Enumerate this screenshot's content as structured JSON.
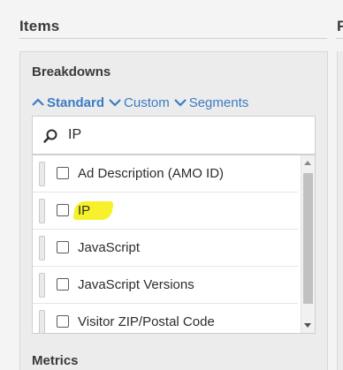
{
  "section": {
    "title": "Items",
    "next_title_fragment": "F"
  },
  "breakdowns": {
    "title": "Breakdowns",
    "filters": [
      {
        "label": "Standard",
        "active": true
      },
      {
        "label": "Custom",
        "active": false
      },
      {
        "label": "Segments",
        "active": false
      }
    ]
  },
  "search": {
    "value": "IP"
  },
  "items": [
    {
      "label": "Ad Description (AMO ID)",
      "checked": false,
      "highlighted": false
    },
    {
      "label": "IP",
      "checked": false,
      "highlighted": true
    },
    {
      "label": "JavaScript",
      "checked": false,
      "highlighted": false
    },
    {
      "label": "JavaScript Versions",
      "checked": false,
      "highlighted": false
    },
    {
      "label": "Visitor ZIP/Postal Code",
      "checked": false,
      "highlighted": false
    }
  ],
  "metrics": {
    "title": "Metrics"
  },
  "colors": {
    "link": "#3b7bc4",
    "highlight": "#f6f12a"
  }
}
